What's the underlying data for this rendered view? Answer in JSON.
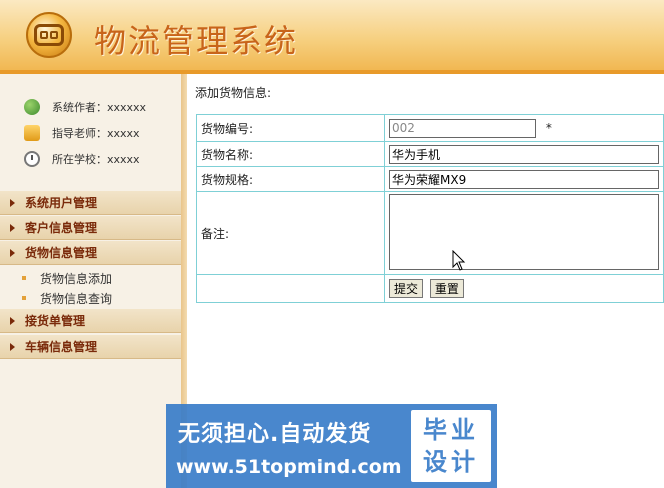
{
  "header": {
    "title": "物流管理系统"
  },
  "sidebar": {
    "info": [
      {
        "label": "系统作者：xxxxxx",
        "icon": "user-group-icon"
      },
      {
        "label": "指导老师：xxxxx",
        "icon": "teacher-icon"
      },
      {
        "label": "所在学校：xxxxx",
        "icon": "clock-icon"
      }
    ],
    "menus": [
      {
        "label": "系统用户管理"
      },
      {
        "label": "客户信息管理"
      },
      {
        "label": "货物信息管理",
        "items": [
          "货物信息添加",
          "货物信息查询"
        ]
      },
      {
        "label": "接货单管理"
      },
      {
        "label": "车辆信息管理"
      }
    ]
  },
  "form": {
    "title": "添加货物信息:",
    "fields": [
      {
        "label": "货物编号:",
        "value": "002",
        "required_mark": "*"
      },
      {
        "label": "货物名称:",
        "value": "华为手机"
      },
      {
        "label": "货物规格:",
        "value": "华为荣耀MX9"
      },
      {
        "label": "备注:",
        "value": ""
      }
    ],
    "submit_label": "提交",
    "reset_label": "重置"
  },
  "watermark": {
    "slogan": "无须担心.自动发货",
    "url": "www.51topmind.com",
    "box_line1": "毕业",
    "box_line2": "设计"
  }
}
